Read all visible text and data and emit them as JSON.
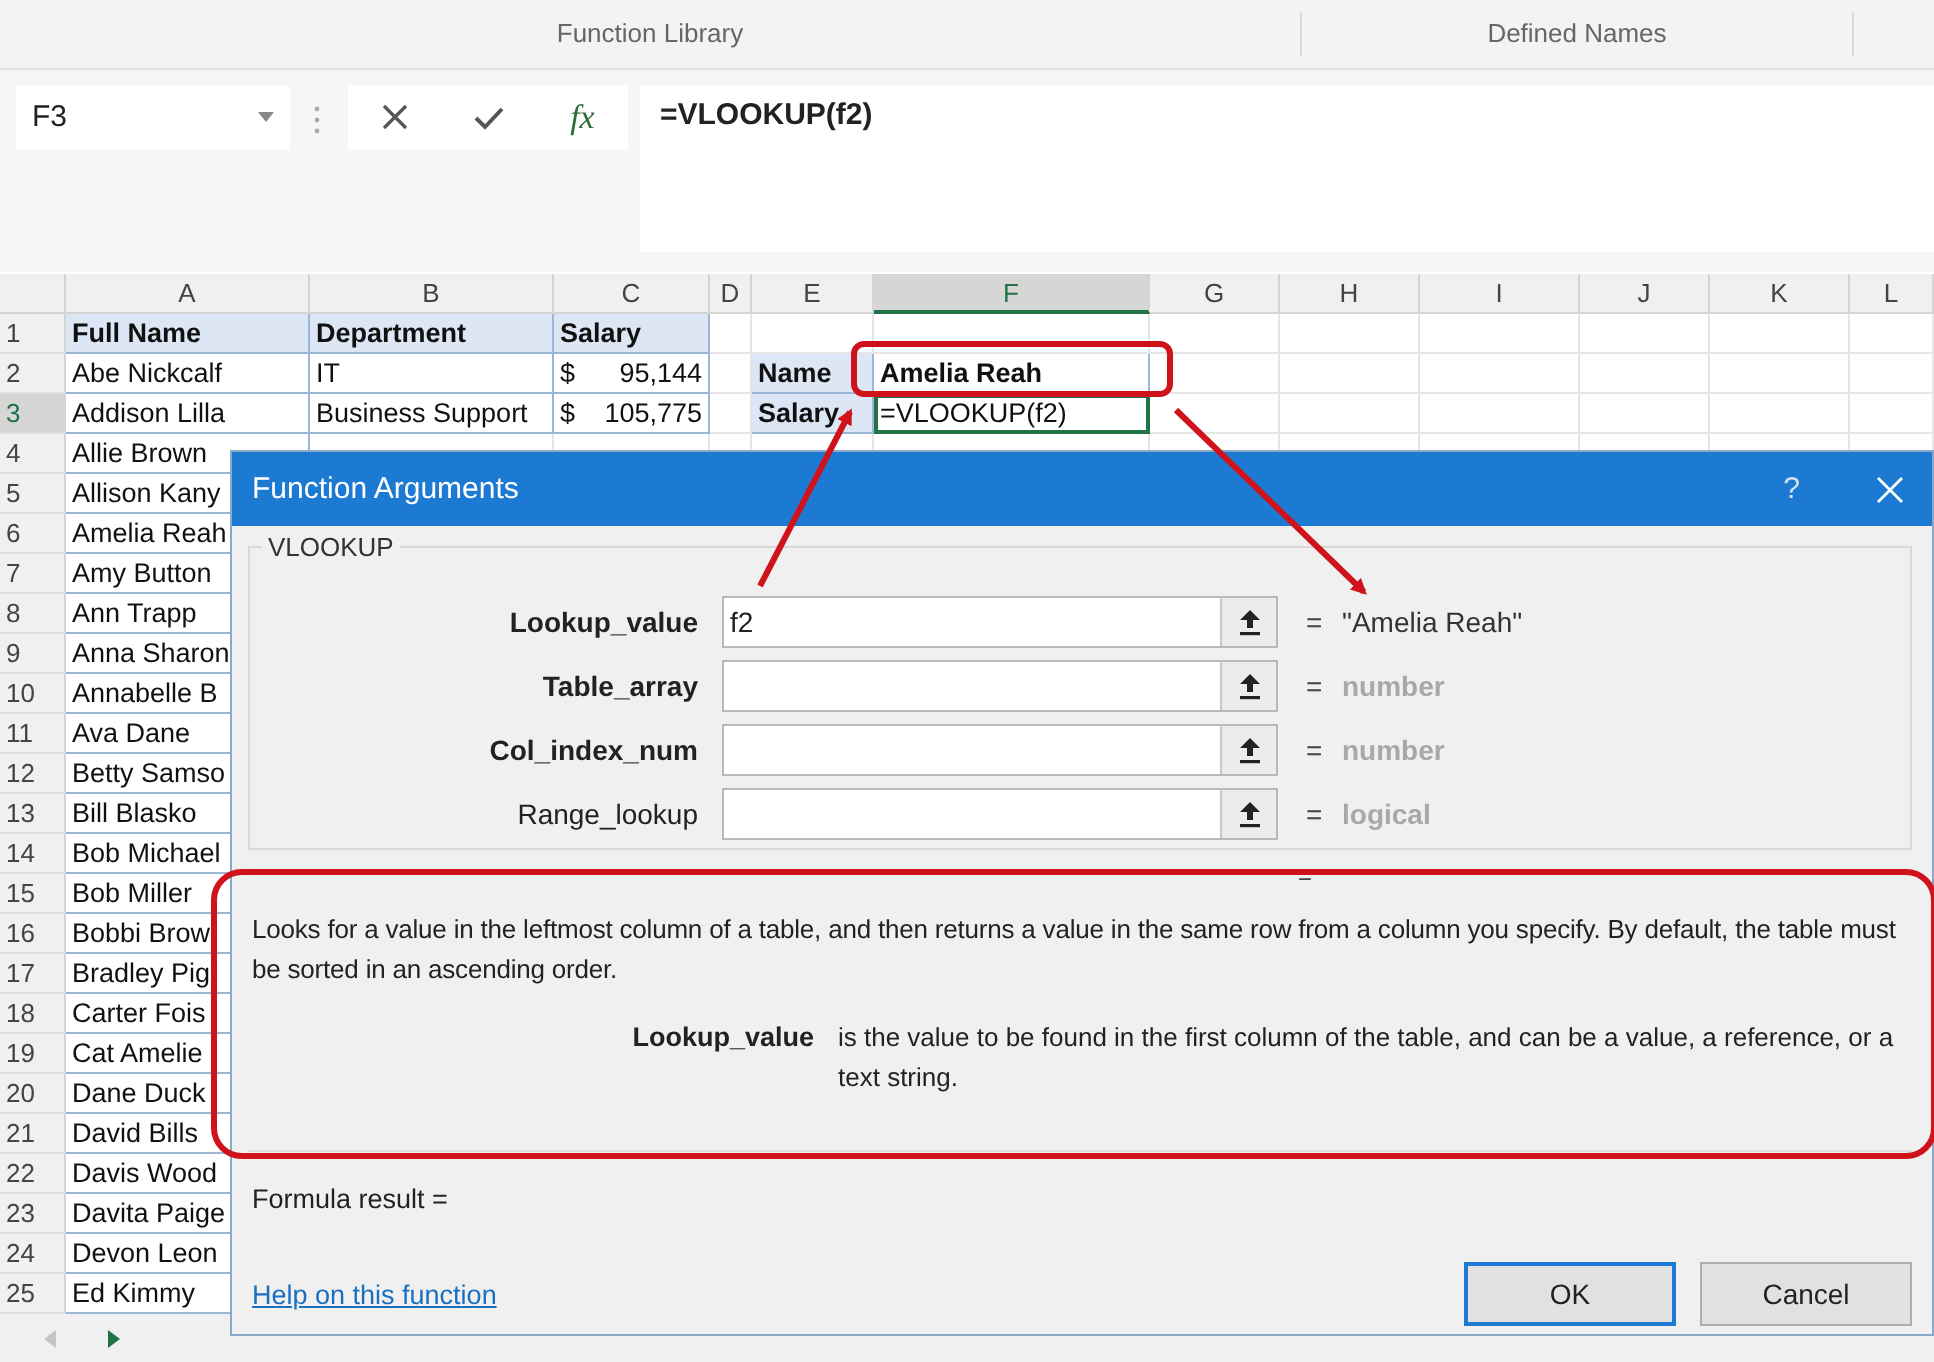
{
  "ribbon": {
    "groups": [
      "Function Library",
      "Defined Names"
    ]
  },
  "formula_bar": {
    "name_box": "F3",
    "function_label": "fx",
    "formula": "=VLOOKUP(f2)"
  },
  "sheet": {
    "columns": [
      {
        "label": "A",
        "selected": false
      },
      {
        "label": "B",
        "selected": false
      },
      {
        "label": "C",
        "selected": false
      },
      {
        "label": "D",
        "selected": false
      },
      {
        "label": "E",
        "selected": false
      },
      {
        "label": "F",
        "selected": true
      },
      {
        "label": "G",
        "selected": false
      },
      {
        "label": "H",
        "selected": false
      },
      {
        "label": "I",
        "selected": false
      },
      {
        "label": "J",
        "selected": false
      },
      {
        "label": "K",
        "selected": false
      },
      {
        "label": "L",
        "selected": false
      }
    ],
    "rows": [
      {
        "number": "1",
        "selected": false,
        "a": "Full Name",
        "b": "Department",
        "c": {
          "amount": "Salary"
        },
        "header": true
      },
      {
        "number": "2",
        "selected": false,
        "a": "Abe Nickcalf",
        "b": "IT",
        "c": {
          "symbol": "$",
          "amount": "95,144"
        },
        "e": "Name",
        "f": "Amelia Reah"
      },
      {
        "number": "3",
        "selected": true,
        "a": "Addison Lilla",
        "b": "Business Support",
        "c": {
          "symbol": "$",
          "amount": "105,775"
        },
        "e": "Salary",
        "f": "=VLOOKUP(f2)"
      },
      {
        "number": "4",
        "selected": false,
        "a": "Allie Brown"
      },
      {
        "number": "5",
        "selected": false,
        "a": "Allison Kany"
      },
      {
        "number": "6",
        "selected": false,
        "a": "Amelia Reah"
      },
      {
        "number": "7",
        "selected": false,
        "a": "Amy Button"
      },
      {
        "number": "8",
        "selected": false,
        "a": "Ann Trapp"
      },
      {
        "number": "9",
        "selected": false,
        "a": "Anna Sharon"
      },
      {
        "number": "10",
        "selected": false,
        "a": "Annabelle B"
      },
      {
        "number": "11",
        "selected": false,
        "a": "Ava Dane"
      },
      {
        "number": "12",
        "selected": false,
        "a": "Betty Samso"
      },
      {
        "number": "13",
        "selected": false,
        "a": "Bill Blasko"
      },
      {
        "number": "14",
        "selected": false,
        "a": "Bob Michael"
      },
      {
        "number": "15",
        "selected": false,
        "a": "Bob Miller"
      },
      {
        "number": "16",
        "selected": false,
        "a": "Bobbi Brow"
      },
      {
        "number": "17",
        "selected": false,
        "a": "Bradley Pig"
      },
      {
        "number": "18",
        "selected": false,
        "a": "Carter Fois"
      },
      {
        "number": "19",
        "selected": false,
        "a": "Cat Amelie"
      },
      {
        "number": "20",
        "selected": false,
        "a": "Dane Duck"
      },
      {
        "number": "21",
        "selected": false,
        "a": "David Bills"
      },
      {
        "number": "22",
        "selected": false,
        "a": "Davis Wood"
      },
      {
        "number": "23",
        "selected": false,
        "a": "Davita Paige"
      },
      {
        "number": "24",
        "selected": false,
        "a": "Devon Leon"
      },
      {
        "number": "25",
        "selected": false,
        "a": "Ed Kimmy"
      }
    ]
  },
  "dialog": {
    "title": "Function Arguments",
    "help": "?",
    "function_name": "VLOOKUP",
    "arguments": [
      {
        "name": "Lookup_value",
        "required": true,
        "value": "f2",
        "result": "\"Amelia Reah\"",
        "resolved": true
      },
      {
        "name": "Table_array",
        "required": true,
        "result": "number",
        "resolved": false
      },
      {
        "name": "Col_index_num",
        "required": true,
        "result": "number",
        "resolved": false
      },
      {
        "name": "Range_lookup",
        "required": false,
        "result": "logical",
        "resolved": false
      }
    ],
    "equals": "=",
    "description": "Looks for a value in the leftmost column of a table, and then returns a value in the same row from a column you specify. By default, the table must be sorted in an ascending order.",
    "argument_help": {
      "name": "Lookup_value",
      "text": "is the value to be found in the first column of the table, and can be a value, a reference, or a text string."
    },
    "formula_result": "Formula result =",
    "help_link": "Help on this function",
    "buttons": [
      {
        "label": "OK",
        "selected": true
      },
      {
        "label": "Cancel",
        "selected": false
      }
    ]
  }
}
